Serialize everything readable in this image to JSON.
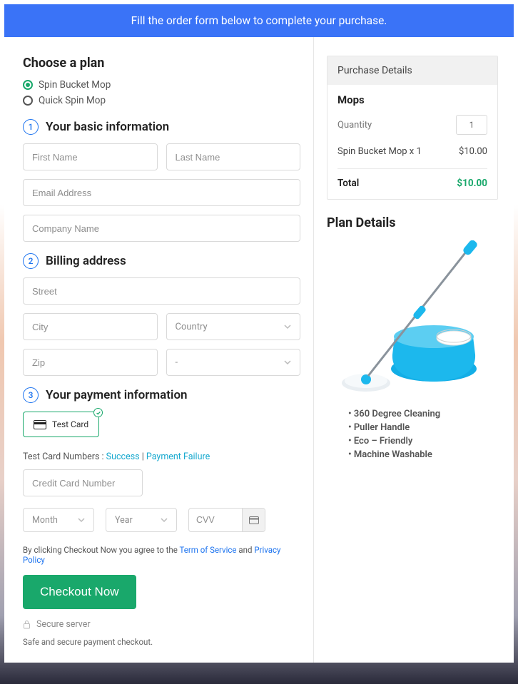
{
  "banner": "Fill the order form below to complete your purchase.",
  "left": {
    "choose_heading": "Choose a plan",
    "plan_options": [
      {
        "label": "Spin Bucket Mop",
        "selected": true
      },
      {
        "label": "Quick Spin Mop",
        "selected": false
      }
    ],
    "step1": {
      "num": "1",
      "title": "Your basic information",
      "first_name_ph": "First Name",
      "last_name_ph": "Last Name",
      "email_ph": "Email Address",
      "company_ph": "Company Name"
    },
    "step2": {
      "num": "2",
      "title": "Billing address",
      "street_ph": "Street",
      "city_ph": "City",
      "country_ph": "Country",
      "zip_ph": "Zip",
      "state_ph": "-"
    },
    "step3": {
      "num": "3",
      "title": "Your payment information",
      "card_label": "Test  Card",
      "test_prefix": "Test Card Numbers : ",
      "test_success": "Success",
      "test_sep": " | ",
      "test_fail": "Payment Failure",
      "cc_ph": "Credit Card Number",
      "month_ph": "Month",
      "year_ph": "Year",
      "cvv_ph": "CVV",
      "agree_pre": "By clicking Checkout Now you agree to the ",
      "tos": "Term of Service",
      "agree_mid": " and ",
      "privacy": "Privacy Policy",
      "checkout_btn": "Checkout Now",
      "secure": "Secure server",
      "safe_note": "Safe and secure payment checkout."
    }
  },
  "right": {
    "panel_title": "Purchase Details",
    "category": "Mops",
    "qty_label": "Quantity",
    "qty_value": "1",
    "line_label": "Spin Bucket Mop x 1",
    "line_price": "$10.00",
    "total_label": "Total",
    "total_price": "$10.00",
    "details_heading": "Plan Details",
    "features": [
      "360 Degree Cleaning",
      "Puller Handle",
      "Eco – Friendly",
      "Machine Washable"
    ]
  }
}
